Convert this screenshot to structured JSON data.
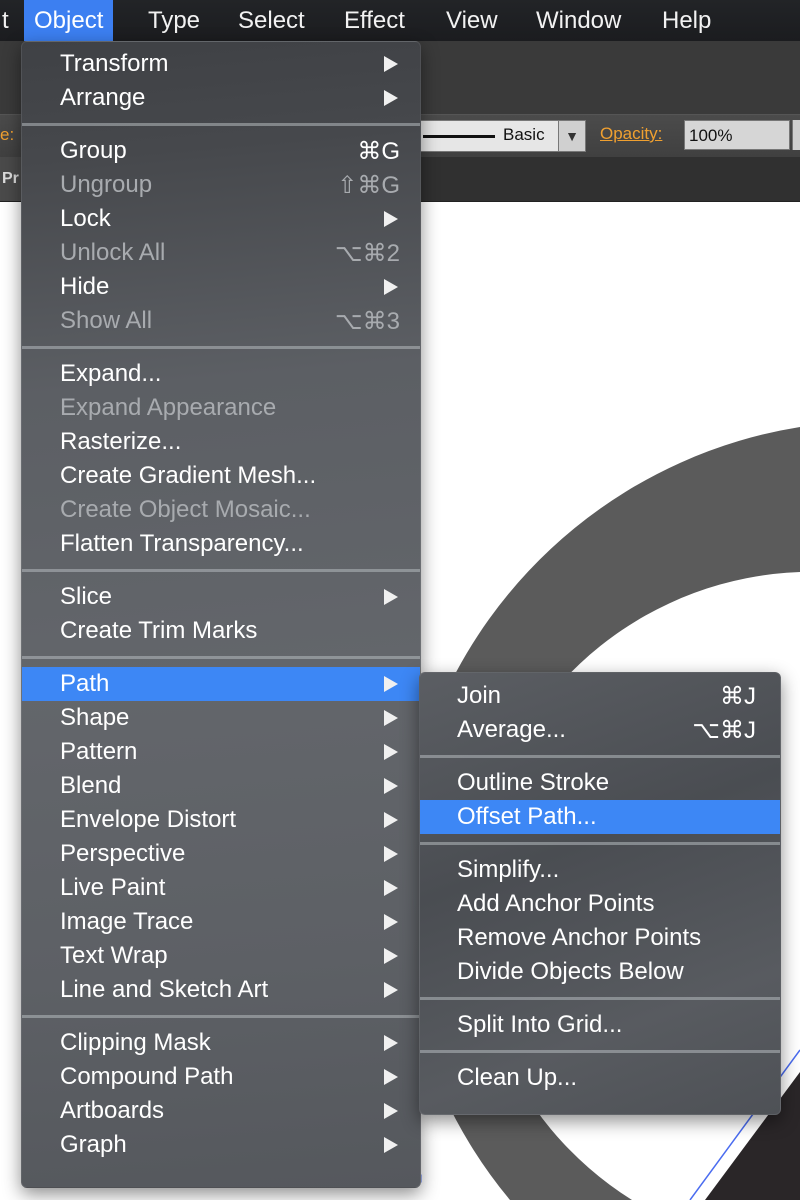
{
  "menubar": {
    "items": [
      "t",
      "Object",
      "Type",
      "Select",
      "Effect",
      "View",
      "Window",
      "Help"
    ],
    "active_index": 1
  },
  "controlbar": {
    "stroke_label": "e:",
    "brush_name": "Basic",
    "opacity_label": "Opacity:",
    "opacity_value": "100%"
  },
  "tabbar": {
    "doc_tab_label": "Pr"
  },
  "object_menu": {
    "groups": [
      [
        {
          "label": "Transform",
          "submenu": true
        },
        {
          "label": "Arrange",
          "submenu": true
        }
      ],
      [
        {
          "label": "Group",
          "shortcut": "⌘G"
        },
        {
          "label": "Ungroup",
          "shortcut": "⇧⌘G",
          "disabled": true
        },
        {
          "label": "Lock",
          "submenu": true
        },
        {
          "label": "Unlock All",
          "shortcut": "⌥⌘2",
          "disabled": true
        },
        {
          "label": "Hide",
          "submenu": true
        },
        {
          "label": "Show All",
          "shortcut": "⌥⌘3",
          "disabled": true
        }
      ],
      [
        {
          "label": "Expand..."
        },
        {
          "label": "Expand Appearance",
          "disabled": true
        },
        {
          "label": "Rasterize..."
        },
        {
          "label": "Create Gradient Mesh..."
        },
        {
          "label": "Create Object Mosaic...",
          "disabled": true
        },
        {
          "label": "Flatten Transparency..."
        }
      ],
      [
        {
          "label": "Slice",
          "submenu": true
        },
        {
          "label": "Create Trim Marks"
        }
      ],
      [
        {
          "label": "Path",
          "submenu": true,
          "highlighted": true
        },
        {
          "label": "Shape",
          "submenu": true
        },
        {
          "label": "Pattern",
          "submenu": true
        },
        {
          "label": "Blend",
          "submenu": true
        },
        {
          "label": "Envelope Distort",
          "submenu": true
        },
        {
          "label": "Perspective",
          "submenu": true
        },
        {
          "label": "Live Paint",
          "submenu": true
        },
        {
          "label": "Image Trace",
          "submenu": true
        },
        {
          "label": "Text Wrap",
          "submenu": true
        },
        {
          "label": "Line and Sketch Art",
          "submenu": true
        }
      ],
      [
        {
          "label": "Clipping Mask",
          "submenu": true
        },
        {
          "label": "Compound Path",
          "submenu": true
        },
        {
          "label": "Artboards",
          "submenu": true
        },
        {
          "label": "Graph",
          "submenu": true
        }
      ]
    ]
  },
  "path_submenu": {
    "groups": [
      [
        {
          "label": "Join",
          "shortcut": "⌘J"
        },
        {
          "label": "Average...",
          "shortcut": "⌥⌘J"
        }
      ],
      [
        {
          "label": "Outline Stroke"
        },
        {
          "label": "Offset Path...",
          "highlighted": true
        }
      ],
      [
        {
          "label": "Simplify..."
        },
        {
          "label": "Add Anchor Points"
        },
        {
          "label": "Remove Anchor Points"
        },
        {
          "label": "Divide Objects Below"
        }
      ],
      [
        {
          "label": "Split Into Grid..."
        }
      ],
      [
        {
          "label": "Clean Up..."
        }
      ]
    ]
  },
  "colors": {
    "menu_highlight": "#3d87f5",
    "menubar_active": "#3c7ff1",
    "accent_label": "#f0a030",
    "artwork_gray": "#5b5b5b",
    "artwork_dark": "#2a2628",
    "selection_blue": "#4a6cf0"
  }
}
